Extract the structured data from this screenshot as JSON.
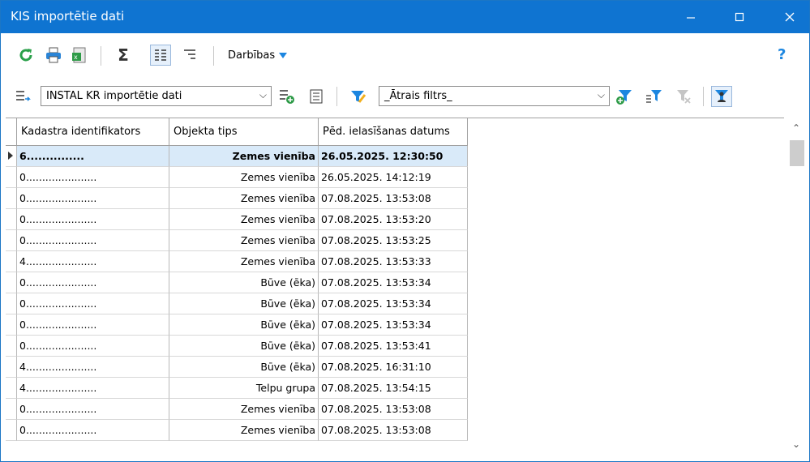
{
  "window": {
    "title": "KIS importētie dati"
  },
  "toolbar": {
    "actions_label": "Darbības",
    "help_label": "?",
    "sum_label": "Σ"
  },
  "filters": {
    "dataset_value": "INSTAL KR importētie dati",
    "quick_filter_value": "_Ātrais filtrs_"
  },
  "grid": {
    "columns": [
      "Kadastra identifikators",
      "Objekta tips",
      "Pēd. ielasīšanas datums"
    ],
    "rows": [
      [
        "6...............",
        "Zemes vienība",
        "26.05.2025. 12:30:50"
      ],
      [
        "0......................",
        "Zemes vienība",
        "26.05.2025. 14:12:19"
      ],
      [
        "0......................",
        "Zemes vienība",
        "07.08.2025. 13:53:08"
      ],
      [
        "0......................",
        "Zemes vienība",
        "07.08.2025. 13:53:20"
      ],
      [
        "0......................",
        "Zemes vienība",
        "07.08.2025. 13:53:25"
      ],
      [
        "4......................",
        "Zemes vienība",
        "07.08.2025. 13:53:33"
      ],
      [
        "0......................",
        "Būve (ēka)",
        "07.08.2025. 13:53:34"
      ],
      [
        "0......................",
        "Būve (ēka)",
        "07.08.2025. 13:53:34"
      ],
      [
        "0......................",
        "Būve (ēka)",
        "07.08.2025. 13:53:34"
      ],
      [
        "0......................",
        "Būve (ēka)",
        "07.08.2025. 13:53:41"
      ],
      [
        "4......................",
        "Būve (ēka)",
        "07.08.2025. 16:31:10"
      ],
      [
        "4......................",
        "Telpu grupa",
        "07.08.2025. 13:54:15"
      ],
      [
        "0......................",
        "Zemes vienība",
        "07.08.2025. 13:53:08"
      ],
      [
        "0......................",
        "Zemes vienība",
        "07.08.2025. 13:53:08"
      ]
    ]
  },
  "colors": {
    "titlebar": "#0f74d1",
    "selected_row": "#d9eaf9",
    "accent": "#1c86e0"
  }
}
